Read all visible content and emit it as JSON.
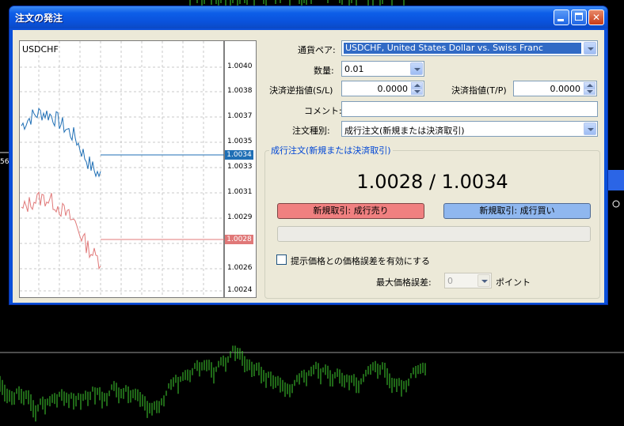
{
  "window": {
    "title": "注文の発注"
  },
  "mini_chart": {
    "symbol": "USDCHF",
    "y_ticks": [
      "1.0040",
      "1.0038",
      "1.0037",
      "1.0035",
      "1.0033",
      "1.0031",
      "1.0029",
      "1.0026",
      "1.0026",
      "1.0024"
    ],
    "ask_tag": "1.0034",
    "bid_tag": "1.0028",
    "colors": {
      "ask": "#1f6fb5",
      "bid": "#e07878"
    }
  },
  "form": {
    "symbol_label": "通貨ペア:",
    "symbol_value": "USDCHF, United States Dollar vs. Swiss Franc",
    "volume_label": "数量:",
    "volume_value": "0.01",
    "sl_label": "決済逆指値(S/L)",
    "sl_value": "0.0000",
    "tp_label": "決済指値(T/P)",
    "tp_value": "0.0000",
    "comment_label": "コメント:",
    "comment_value": "",
    "type_label": "注文種別:",
    "type_value": "成行注文(新規または決済取引)"
  },
  "market": {
    "group_label": "成行注文(新規または決済取引)",
    "price_display": "1.0028 / 1.0034",
    "sell_button": "新規取引:  成行売り",
    "buy_button": "新規取引:  成行買い",
    "deviation_checkbox_label": "提示価格との価格誤差を有効にする",
    "deviation_checked": false,
    "max_deviation_label": "最大価格誤差:",
    "max_deviation_value": "0",
    "points_label": "ポイント"
  },
  "background": {
    "left_edge_text": "56"
  }
}
